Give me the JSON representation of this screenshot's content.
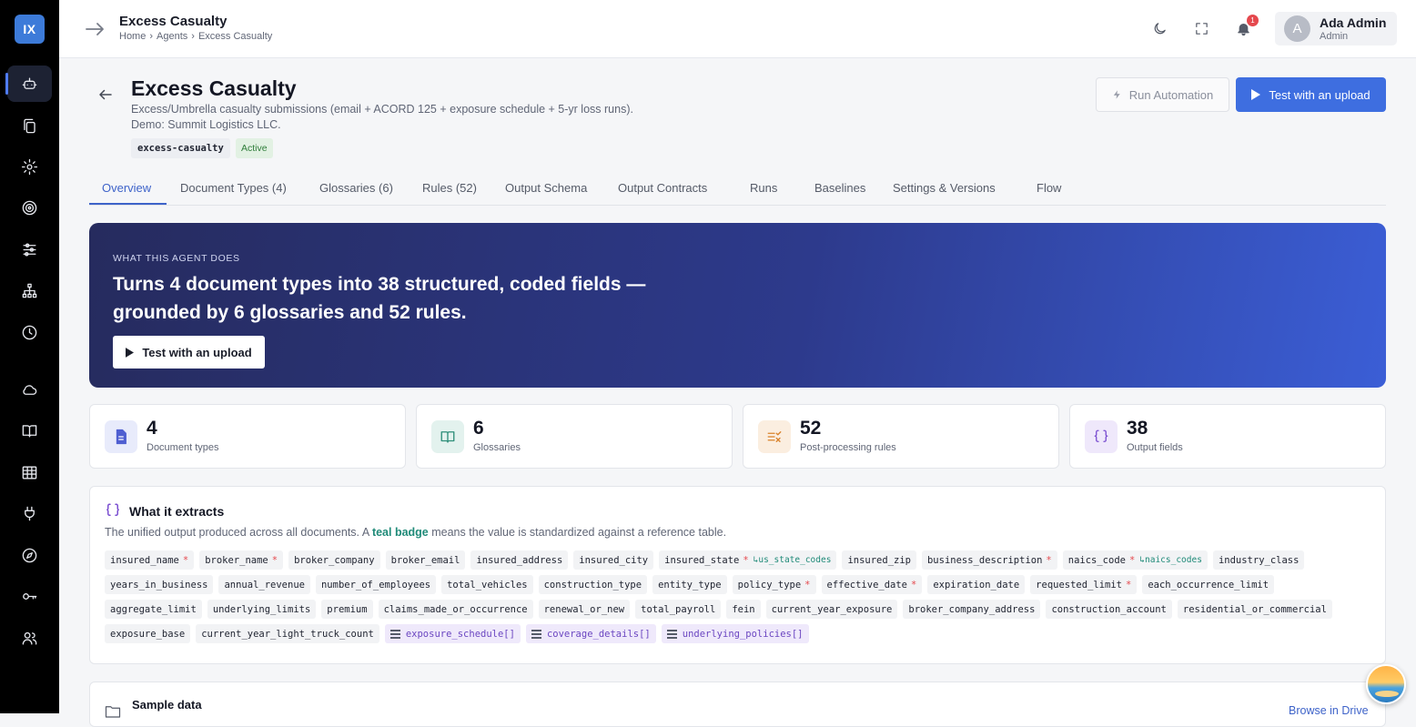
{
  "app": {
    "logo": "IX"
  },
  "sidebar": {
    "items": [
      {
        "name": "agents",
        "icon": "robot-icon",
        "active": true
      },
      {
        "name": "documents",
        "icon": "copy-icon"
      },
      {
        "name": "settings",
        "icon": "gear-icon"
      },
      {
        "name": "targets",
        "icon": "target-icon"
      },
      {
        "name": "filters",
        "icon": "sliders-icon"
      },
      {
        "name": "hierarchy",
        "icon": "hierarchy-icon"
      },
      {
        "name": "history",
        "icon": "clock-icon"
      },
      {
        "name": "cloud",
        "icon": "cloud-icon"
      },
      {
        "name": "library",
        "icon": "book-icon"
      },
      {
        "name": "tables",
        "icon": "table-icon"
      },
      {
        "name": "integrations",
        "icon": "plug-icon"
      },
      {
        "name": "explore",
        "icon": "compass-icon"
      },
      {
        "name": "keys",
        "icon": "key-icon"
      },
      {
        "name": "users",
        "icon": "users-icon"
      }
    ]
  },
  "topbar": {
    "title": "Excess Casualty",
    "breadcrumb": [
      "Home",
      "›",
      "Agents",
      "›",
      "Excess Casualty"
    ],
    "notifications": "1",
    "user": {
      "initial": "A",
      "name": "Ada Admin",
      "role": "Admin"
    }
  },
  "page": {
    "title": "Excess Casualty",
    "description": "Excess/Umbrella casualty submissions (email + ACORD 125 + exposure schedule + 5-yr loss runs).",
    "demo": "Demo: Summit Logistics LLC.",
    "slug": "excess-casualty",
    "status": "Active",
    "status_color": "#2f7d3a",
    "run_automation": "Run Automation",
    "test_upload": "Test with an upload"
  },
  "tabs": [
    "Overview",
    "Document Types (4)",
    "Glossaries (6)",
    "Rules (52)",
    "Output Schema",
    "Output Contracts",
    "Runs",
    "Baselines",
    "Settings & Versions",
    "Flow"
  ],
  "hero": {
    "eyebrow": "WHAT THIS AGENT DOES",
    "headline": "Turns 4 document types into 38 structured, coded fields — grounded by 6 glossaries and 52 rules.",
    "button": "Test with an upload"
  },
  "stats": [
    {
      "value": "4",
      "label": "Document types",
      "icon": "document-icon",
      "color": "#4f5fd1"
    },
    {
      "value": "6",
      "label": "Glossaries",
      "icon": "book-open-icon",
      "color": "#2f8f7a"
    },
    {
      "value": "52",
      "label": "Post-processing rules",
      "icon": "rules-icon",
      "color": "#d9822b"
    },
    {
      "value": "38",
      "label": "Output fields",
      "icon": "braces-icon",
      "color": "#7b4fd1"
    }
  ],
  "extract": {
    "title": "What it extracts",
    "subtitle_pre": "The unified output produced across all documents. A ",
    "subtitle_badge": "teal badge",
    "subtitle_post": " means the value is standardized against a reference table.",
    "fields": [
      {
        "name": "insured_name",
        "req": "*"
      },
      {
        "name": "broker_name",
        "req": "*"
      },
      {
        "name": "broker_company"
      },
      {
        "name": "broker_email"
      },
      {
        "name": "insured_address"
      },
      {
        "name": "insured_city"
      },
      {
        "name": "insured_state",
        "req": "*",
        "ref": "↳us_state_codes"
      },
      {
        "name": "insured_zip"
      },
      {
        "name": "business_description",
        "req": "*"
      },
      {
        "name": "naics_code",
        "req": "*",
        "ref": "↳naics_codes"
      },
      {
        "name": "industry_class"
      },
      {
        "name": "years_in_business"
      },
      {
        "name": "annual_revenue"
      },
      {
        "name": "number_of_employees"
      },
      {
        "name": "total_vehicles"
      },
      {
        "name": "construction_type"
      },
      {
        "name": "entity_type"
      },
      {
        "name": "policy_type",
        "req": "*"
      },
      {
        "name": "effective_date",
        "req": "*"
      },
      {
        "name": "expiration_date"
      },
      {
        "name": "requested_limit",
        "req": "*"
      },
      {
        "name": "each_occurrence_limit"
      },
      {
        "name": "aggregate_limit"
      },
      {
        "name": "underlying_limits"
      },
      {
        "name": "premium"
      },
      {
        "name": "claims_made_or_occurrence"
      },
      {
        "name": "renewal_or_new"
      },
      {
        "name": "total_payroll"
      },
      {
        "name": "fein"
      },
      {
        "name": "current_year_exposure"
      },
      {
        "name": "broker_company_address"
      },
      {
        "name": "construction_account"
      },
      {
        "name": "residential_or_commercial"
      },
      {
        "name": "exposure_base"
      },
      {
        "name": "current_year_light_truck_count"
      },
      {
        "name": "exposure_schedule[]",
        "array": true
      },
      {
        "name": "coverage_details[]",
        "array": true
      },
      {
        "name": "underlying_policies[]",
        "array": true
      }
    ]
  },
  "sample": {
    "title": "Sample data",
    "link": "Browse in Drive"
  }
}
